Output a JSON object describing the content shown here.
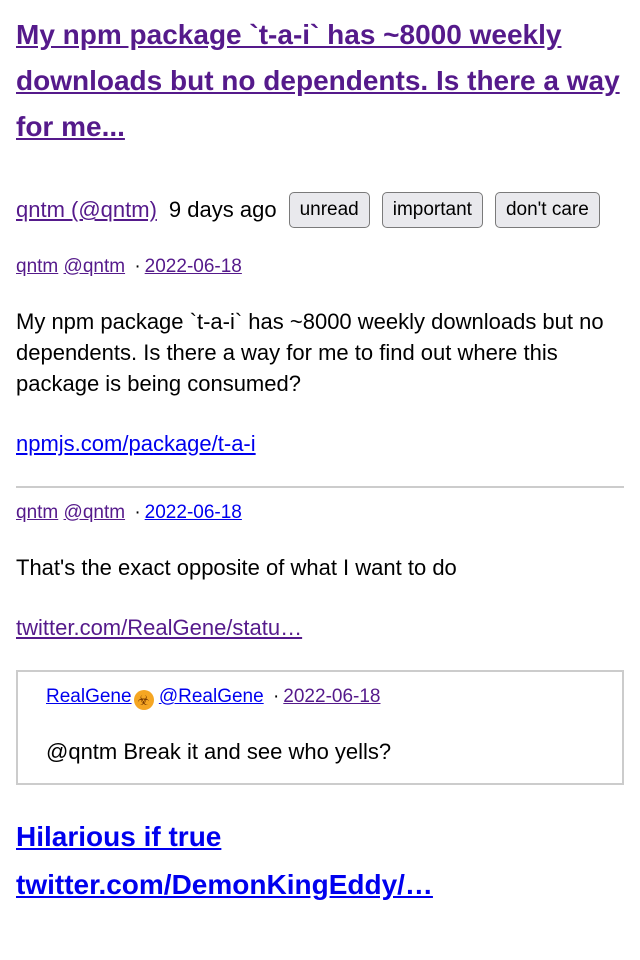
{
  "story": {
    "title": "My npm package `t-a-i` has ~8000 weekly downloads but no dependents. Is there a way for me...",
    "author": "qntm (@qntm)",
    "age": "9 days ago",
    "buttons": [
      "unread",
      "important",
      "don't care"
    ]
  },
  "tweets": [
    {
      "name": "qntm",
      "handle": "@qntm",
      "separator": "·",
      "date": "2022-06-18",
      "text": "My npm package `t-a-i` has ~8000 weekly downloads but no dependents. Is there a way for me to find out where this package is being consumed?",
      "link": "npmjs.com/package/t-a-i"
    },
    {
      "name": "qntm",
      "handle": "@qntm",
      "separator": "·",
      "date": "2022-06-18",
      "text": "That's the exact opposite of what I want to do",
      "link": "twitter.com/RealGene/statu…",
      "quote": {
        "name": "RealGene",
        "emoji": "☣",
        "handle": "@RealGene",
        "separator": "·",
        "date": "2022-06-18",
        "text": "@qntm Break it and see who yells?"
      }
    }
  ],
  "bottom": {
    "heading_link": "Hilarious if true",
    "url_link": "twitter.com/DemonKingEddy/…"
  },
  "colors": {
    "visited_link": "#551a8b",
    "unvisited_link": "#0000ee",
    "divider": "#cccccc",
    "button_bg": "#e9e9ed"
  }
}
